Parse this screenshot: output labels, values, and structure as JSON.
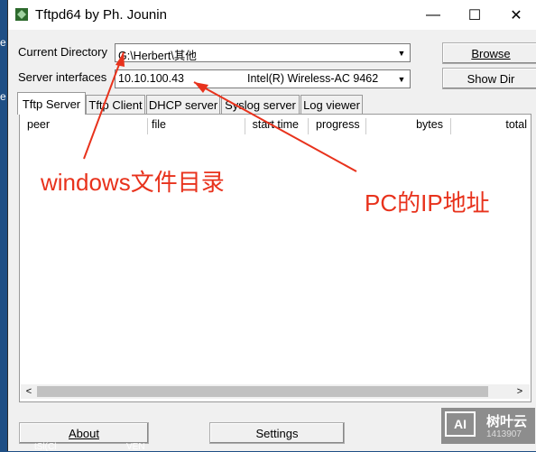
{
  "window": {
    "title": "Tftpd64 by Ph. Jounin"
  },
  "controls": {
    "minimize": "—",
    "maximize": "☐",
    "close": "✕"
  },
  "form": {
    "current_directory_label": "Current Directory",
    "current_directory_value": "G:\\Herbert\\其他",
    "server_interfaces_label": "Server interfaces",
    "server_ip": "10.10.100.43",
    "server_adapter": "Intel(R) Wireless-AC 9462",
    "browse_label": "Browse",
    "showdir_label": "Show Dir"
  },
  "tabs": [
    {
      "label": "Tftp Server",
      "active": true
    },
    {
      "label": "Tftp Client"
    },
    {
      "label": "DHCP server"
    },
    {
      "label": "Syslog server"
    },
    {
      "label": "Log viewer"
    }
  ],
  "table": {
    "columns": [
      "peer",
      "file",
      "start time",
      "progress",
      "bytes",
      "total"
    ]
  },
  "annotations": {
    "dir_note": "windows文件目录",
    "ip_note": "PC的IP地址"
  },
  "buttons": {
    "about": "About",
    "settings": "Settings"
  },
  "watermark": {
    "text": "树叶云",
    "sub": "1413907"
  },
  "background_text": {
    "left1": "e",
    "left2": "e",
    "bottom_left": "tSl(Cl",
    "bottom_mid": "VEN"
  }
}
